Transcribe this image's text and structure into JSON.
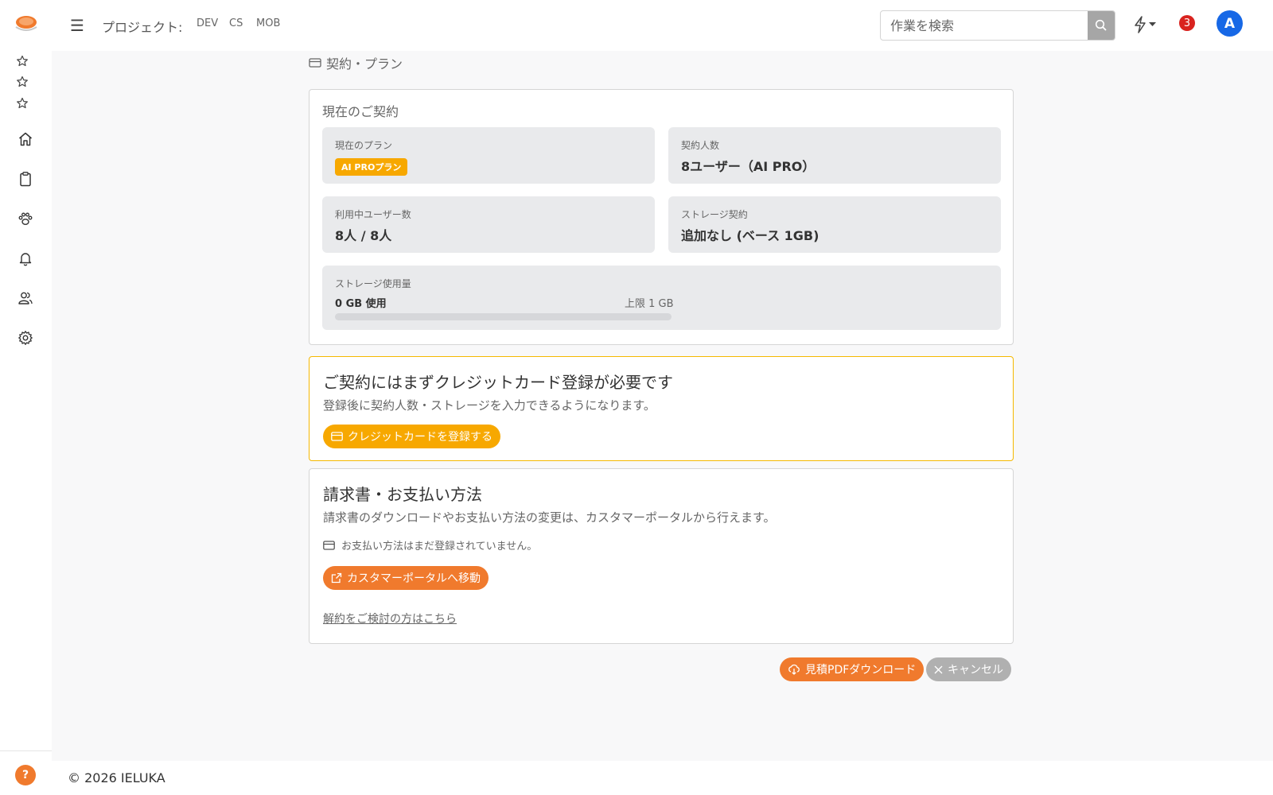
{
  "header": {
    "project_label": "プロジェクト:",
    "projects": [
      "DEV",
      "CS",
      "MOB"
    ],
    "search_placeholder": "作業を検索",
    "notification_count": "3",
    "avatar_initial": "A",
    "logo_color": "#f07a2d"
  },
  "sidebar": {
    "icons": [
      "star-icon",
      "star-icon",
      "star-icon",
      "home-icon",
      "clipboard-icon",
      "paw-icon",
      "bell-icon",
      "users-icon",
      "gear-icon"
    ],
    "help_label": "?"
  },
  "page": {
    "title": "契約・プラン"
  },
  "contract": {
    "heading": "現在のご契約",
    "plan_label": "現在のプラン",
    "plan_badge": "AI PROプラン",
    "seats_label": "契約人数",
    "seats_value": "8ユーザー（AI PRO）",
    "users_label": "利用中ユーザー数",
    "users_value": "8人 / 8人",
    "storage_contract_label": "ストレージ契約",
    "storage_contract_value": "追加なし (ベース 1GB)",
    "storage_usage_label": "ストレージ使用量",
    "storage_used": "0 GB 使用",
    "storage_limit": "上限 1 GB",
    "storage_fraction": 0
  },
  "card_notice": {
    "title": "ご契約にはまずクレジットカード登録が必要です",
    "desc": "登録後に契約人数・ストレージを入力できるようになります。",
    "button": "クレジットカードを登録する"
  },
  "billing": {
    "title": "請求書・お支払い方法",
    "desc": "請求書のダウンロードやお支払い方法の変更は、カスタマーポータルから行えます。",
    "note": "お支払い方法はまだ登録されていません。",
    "portal_button": "カスタマーポータルへ移動",
    "cancel_link": "解約をご検討の方はこちら"
  },
  "actions": {
    "pdf_button": "見積PDFダウンロード",
    "cancel_button": "キャンセル"
  },
  "footer": {
    "copyright": "© 2026 IELUKA"
  },
  "colors": {
    "accent_orange": "#f07a2d",
    "accent_yellow": "#f7a800",
    "avatar_blue": "#1768e6",
    "notif_red": "#d9231f"
  }
}
